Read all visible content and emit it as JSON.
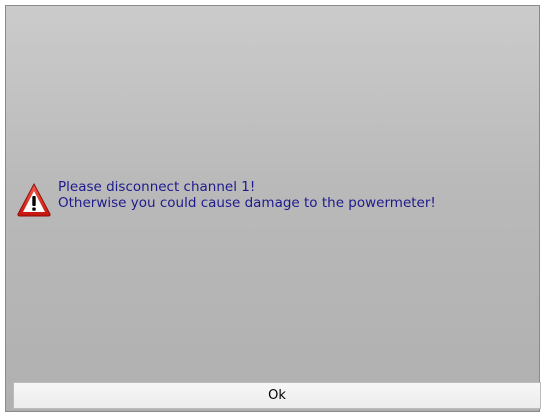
{
  "dialog": {
    "icon": "warning-triangle-icon",
    "message_line_1": "Please disconnect channel 1!",
    "message_line_2": "Otherwise you could cause damage to the powermeter!",
    "ok_label": "Ok"
  },
  "colors": {
    "message_text": "#1e1a8c",
    "warning_red": "#d8261a",
    "background": "#b9b9b9"
  }
}
